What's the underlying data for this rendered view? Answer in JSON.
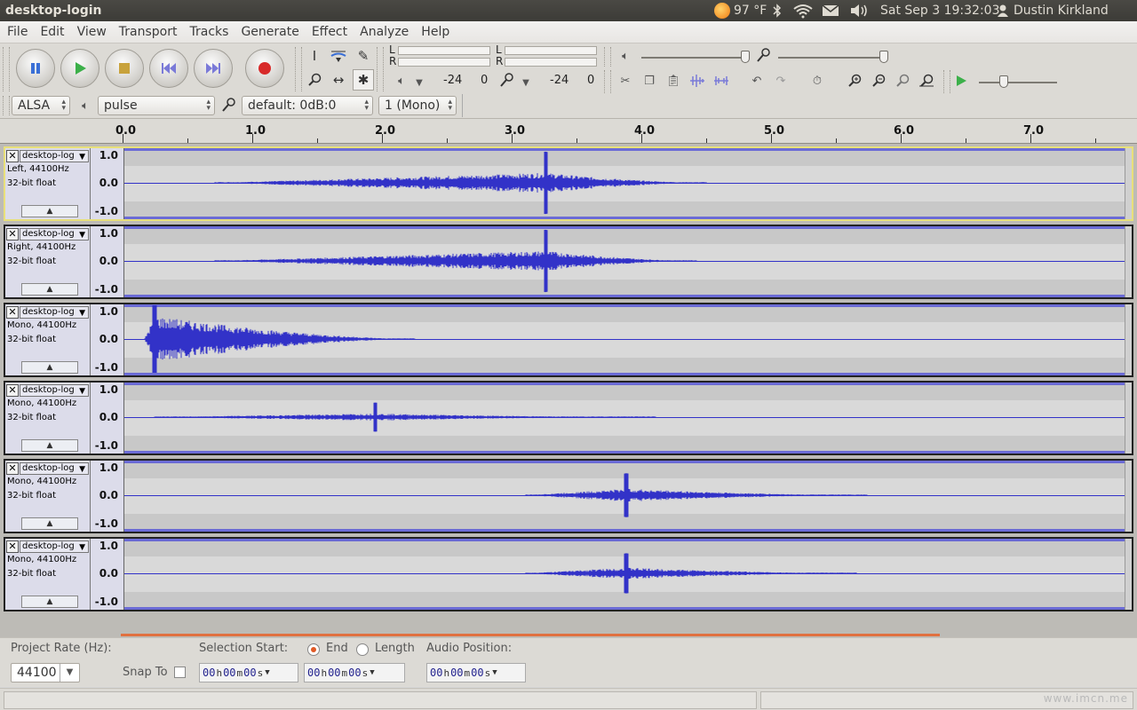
{
  "topbar": {
    "window_title": "desktop-login",
    "temperature": "97 °F",
    "datetime": "Sat Sep 3 19:32:03",
    "user": "Dustin Kirkland"
  },
  "menu": [
    "File",
    "Edit",
    "View",
    "Transport",
    "Tracks",
    "Generate",
    "Effect",
    "Analyze",
    "Help"
  ],
  "meters": {
    "play_left": "L",
    "play_right": "R",
    "rec_left": "L",
    "rec_right": "R",
    "play_db": "-24",
    "play_zero": "0",
    "rec_db": "-24",
    "rec_zero": "0"
  },
  "device": {
    "host": "ALSA",
    "output": "pulse",
    "input": "default: 0dB:0",
    "channels": "1 (Mono)"
  },
  "ruler": [
    "0.0",
    "1.0",
    "2.0",
    "3.0",
    "4.0",
    "5.0",
    "6.0",
    "7.0"
  ],
  "tracks": [
    {
      "name": "desktop-log",
      "line1": "Left, 44100Hz",
      "line2": "32-bit float",
      "selected": true
    },
    {
      "name": "desktop-log",
      "line1": "Right, 44100Hz",
      "line2": "32-bit float",
      "selected": false
    },
    {
      "name": "desktop-log",
      "line1": "Mono, 44100Hz",
      "line2": "32-bit float",
      "selected": false
    },
    {
      "name": "desktop-log",
      "line1": "Mono, 44100Hz",
      "line2": "32-bit float",
      "selected": false
    },
    {
      "name": "desktop-log",
      "line1": "Mono, 44100Hz",
      "line2": "32-bit float",
      "selected": false
    },
    {
      "name": "desktop-log",
      "line1": "Mono, 44100Hz",
      "line2": "32-bit float",
      "selected": false
    }
  ],
  "scale": {
    "top": "1.0",
    "mid": "0.0",
    "bot": "-1.0"
  },
  "bottom": {
    "project_rate_label": "Project Rate (Hz):",
    "project_rate": "44100",
    "snap_to": "Snap To",
    "selection_start": "Selection Start:",
    "end_label": "End",
    "length_label": "Length",
    "audio_position": "Audio Position:",
    "time_h": "00",
    "time_m": "00",
    "time_s": "00",
    "u_h": "h",
    "u_m": "m",
    "u_s": "s"
  },
  "watermark": "www.imcn.me",
  "colors": {
    "waveform": "#3232c8",
    "accent": "#e05a26"
  }
}
